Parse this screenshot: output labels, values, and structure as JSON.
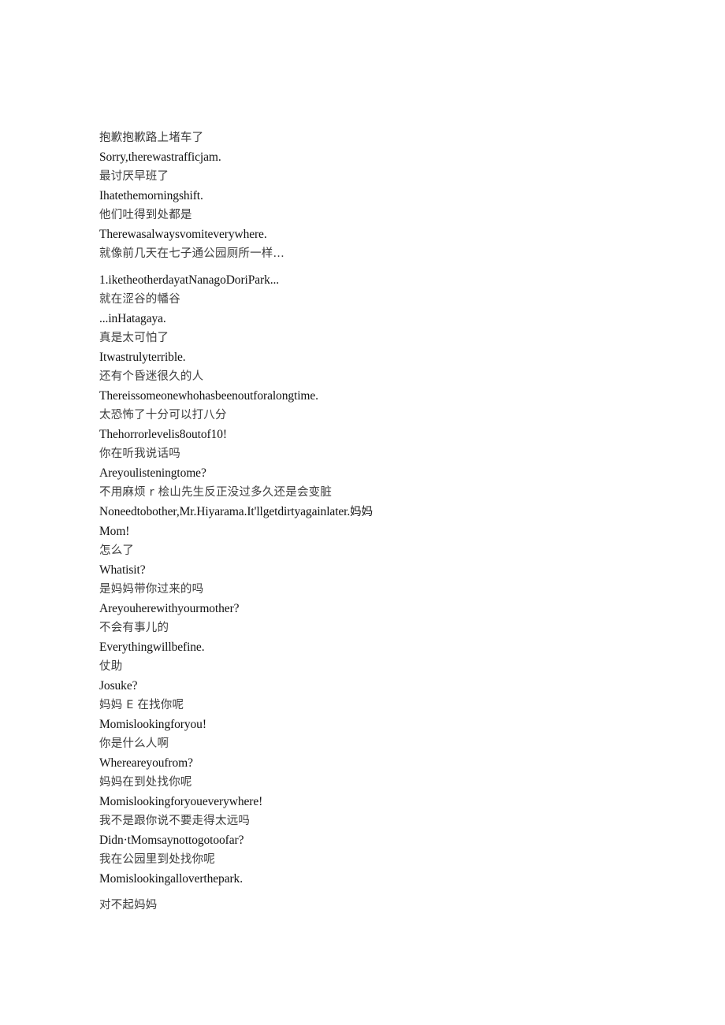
{
  "document": {
    "type": "bilingual-subtitle-transcript",
    "background_color": "#ffffff",
    "zh_text_color": "#3d3d3d",
    "en_text_color": "#111111",
    "lines": [
      {
        "lang": "zh",
        "text": "抱歉抱歉路上堵车了"
      },
      {
        "lang": "en",
        "text": "Sorry,therewastrafficjam."
      },
      {
        "lang": "zh",
        "text": "最讨厌早班了"
      },
      {
        "lang": "en",
        "text": "Ihatethemorningshift."
      },
      {
        "lang": "zh",
        "text": "他们吐得到处都是"
      },
      {
        "lang": "en",
        "text": "Therewasalwaysvomiteverywhere."
      },
      {
        "lang": "zh",
        "text": "就像前几天在七子通公园厕所一样...",
        "gap_after": true
      },
      {
        "lang": "en",
        "text": "1.iketheotherdayatNanagoDoriPark...",
        "gap_before": true
      },
      {
        "lang": "zh",
        "text": "就在涩谷的幡谷"
      },
      {
        "lang": "en",
        "text": "...inHatagaya."
      },
      {
        "lang": "zh",
        "text": "真是太可怕了"
      },
      {
        "lang": "en",
        "text": "Itwastrulyterrible."
      },
      {
        "lang": "zh",
        "text": "还有个昏迷很久的人"
      },
      {
        "lang": "en",
        "text": "Thereissomeonewhohasbeenoutforalongtime."
      },
      {
        "lang": "zh",
        "text": "太恐怖了十分可以打八分"
      },
      {
        "lang": "en",
        "text": "Thehorrorlevelis8outof10!"
      },
      {
        "lang": "zh",
        "text": "你在听我说话吗"
      },
      {
        "lang": "en",
        "text": "Areyoulisteningtome?"
      },
      {
        "lang": "zh",
        "text": "不用麻烦 r 桧山先生反正没过多久还是会变脏"
      },
      {
        "lang": "en",
        "text": "Noneedtobother,Mr.Hiyarama.It'llgetdirtyagainlater.",
        "cjk_tail": "妈妈"
      },
      {
        "lang": "en",
        "text": "Mom!"
      },
      {
        "lang": "zh",
        "text": "怎么了"
      },
      {
        "lang": "en",
        "text": "Whatisit?"
      },
      {
        "lang": "zh",
        "text": "是妈妈带你过来的吗"
      },
      {
        "lang": "en",
        "text": "Areyouherewithyourmother?"
      },
      {
        "lang": "zh",
        "text": "不会有事儿的"
      },
      {
        "lang": "en",
        "text": "Everythingwillbefine."
      },
      {
        "lang": "zh",
        "text": "仗助"
      },
      {
        "lang": "en",
        "text": "Josuke?"
      },
      {
        "lang": "zh",
        "text": "妈妈 E 在找你呢"
      },
      {
        "lang": "en",
        "text": "Momislookingforyou!"
      },
      {
        "lang": "zh",
        "text": "你是什么人啊"
      },
      {
        "lang": "en",
        "text": "Whereareyoufrom?"
      },
      {
        "lang": "zh",
        "text": "妈妈在到处找你呢"
      },
      {
        "lang": "en",
        "text": "Momislookingforyoueverywhere!"
      },
      {
        "lang": "zh",
        "text": "我不是跟你说不要走得太远吗"
      },
      {
        "lang": "en",
        "text": "Didn·tMomsaynottogotoofar?"
      },
      {
        "lang": "zh",
        "text": "我在公园里到处找你呢"
      },
      {
        "lang": "en",
        "text": "Momislookingalloverthepark.",
        "gap_after": true
      },
      {
        "lang": "zh",
        "text": "对不起妈妈",
        "gap_before": true
      }
    ]
  }
}
